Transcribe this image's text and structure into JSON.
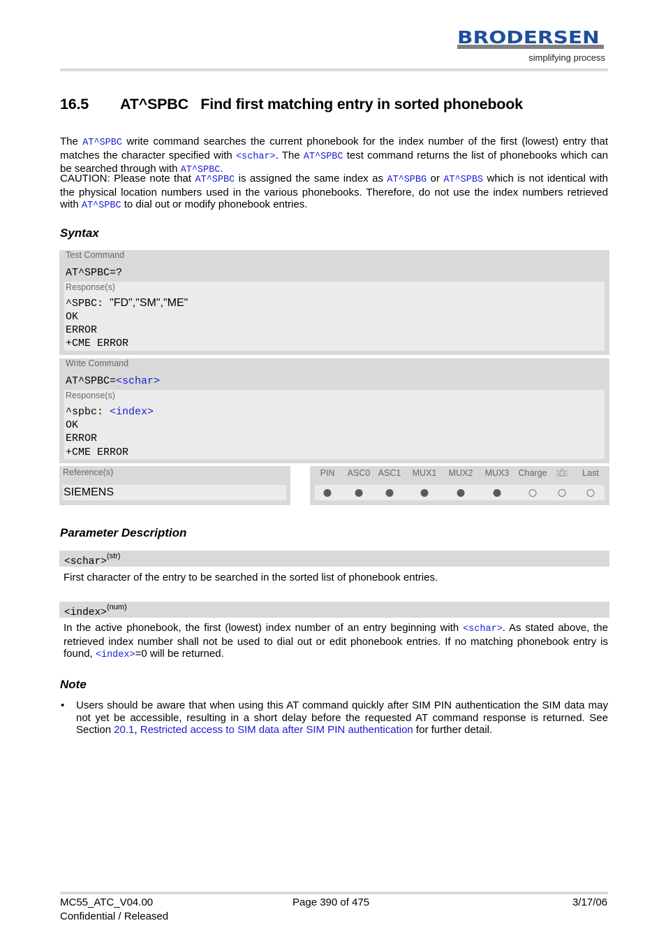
{
  "header": {
    "logo_text": "BRODERSEN",
    "logo_tagline": "simplifying process",
    "brand_color": "#1f4e9c"
  },
  "section": {
    "number": "16.5",
    "title": "AT^SPBC   Find first matching entry in sorted phonebook"
  },
  "intro": {
    "p1_a": "The ",
    "p1_cmd1": "AT^SPBC",
    "p1_b": " write command searches the current phonebook for the index number of the first (lowest) entry that matches the character specified with ",
    "p1_param": "<schar>",
    "p1_c": ". The ",
    "p1_cmd2": "AT^SPBC",
    "p1_d": " test command returns the list of phonebooks which can be searched through with ",
    "p1_cmd3": "AT^SPBC",
    "p1_e": ".",
    "p2_a": "CAUTION: Please note that ",
    "p2_cmd1": "AT^SPBC",
    "p2_b": " is assigned the same index as ",
    "p2_cmd2": "AT^SPBG",
    "p2_c": " or ",
    "p2_cmd3": "AT^SPBS",
    "p2_d": " which is not identical with the physical location numbers used in the various phonebooks. Therefore, do not use the index numbers retrieved with ",
    "p2_cmd4": "AT^SPBC",
    "p2_e": " to dial out or modify phonebook entries."
  },
  "syntax": {
    "heading": "Syntax",
    "test": {
      "label": "Test Command",
      "command": "AT^SPBC=?",
      "response_label": "Response(s)",
      "resp_prefix": "^SPBC: ",
      "resp_value": "\"FD\",\"SM\",\"ME\"",
      "lines": [
        "OK",
        "ERROR",
        "+CME ERROR"
      ]
    },
    "write": {
      "label": "Write Command",
      "command_prefix": "AT^SPBC=",
      "command_param": "<schar>",
      "response_label": "Response(s)",
      "resp_prefix": "^spbc: ",
      "resp_param": "<index>",
      "lines": [
        "OK",
        "ERROR",
        "+CME ERROR"
      ]
    },
    "reference": {
      "label": "Reference(s)",
      "value": "SIEMENS"
    },
    "flags": [
      {
        "label": "PIN",
        "state": "filled"
      },
      {
        "label": "ASC0",
        "state": "filled"
      },
      {
        "label": "ASC1",
        "state": "filled"
      },
      {
        "label": "MUX1",
        "state": "filled"
      },
      {
        "label": "MUX2",
        "state": "filled"
      },
      {
        "label": "MUX3",
        "state": "filled"
      },
      {
        "label": "Charge",
        "state": "empty"
      },
      {
        "label": "alarm-icon",
        "state": "empty"
      },
      {
        "label": "Last",
        "state": "empty"
      }
    ]
  },
  "params": {
    "heading": "Parameter Description",
    "schar": {
      "name": "<schar>",
      "type": "(str)",
      "desc": "First character of the entry to be searched in the sorted list of phonebook entries."
    },
    "index": {
      "name": "<index>",
      "type": "(num)",
      "desc_a": "In the active phonebook, the first (lowest) index number of an entry beginning with ",
      "desc_param1": "<schar>",
      "desc_b": ". As stated above, the retrieved index number shall not be used to dial out or edit phonebook entries. If no matching phonebook entry is found, ",
      "desc_param2": "<index>",
      "desc_c": "=0 will be returned."
    }
  },
  "note": {
    "heading": "Note",
    "bullet": "•",
    "text_a": "Users should be aware that when using this AT command quickly after SIM PIN authentication the SIM data may not yet be accessible, resulting in a short delay before the requested AT command response is returned. See Section ",
    "link_section": "20.1",
    "text_b": ", ",
    "link_title": "Restricted access to SIM data after SIM PIN authentication",
    "text_c": " for further detail."
  },
  "footer": {
    "doc_id": "MC55_ATC_V04.00",
    "status": "Confidential / Released",
    "page": "Page 390 of 475",
    "date": "3/17/06"
  }
}
